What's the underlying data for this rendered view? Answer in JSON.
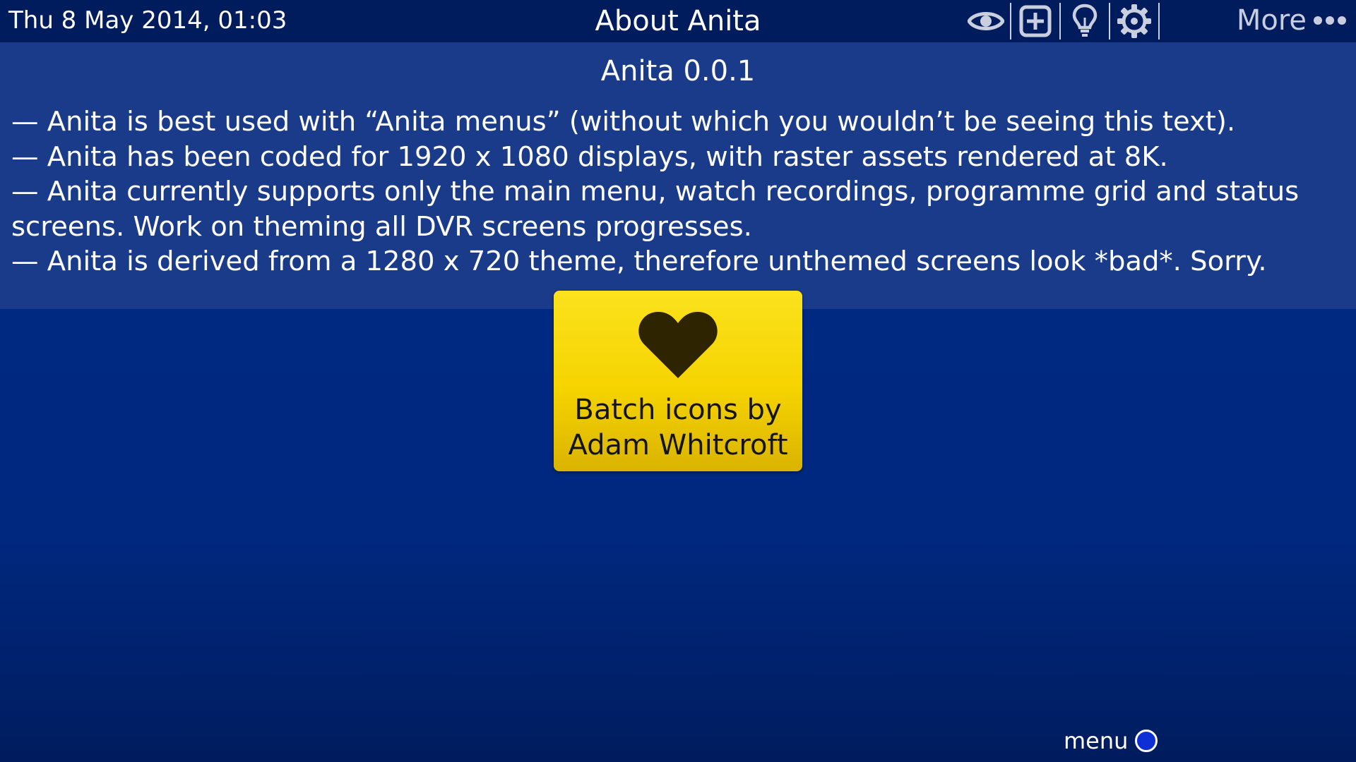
{
  "header": {
    "datetime": "Thu 8 May 2014, 01:03",
    "title": "About Anita",
    "icons": [
      {
        "name": "eye-icon"
      },
      {
        "name": "add-icon"
      },
      {
        "name": "lightbulb-icon"
      },
      {
        "name": "gear-icon"
      }
    ],
    "more_label": "More"
  },
  "info": {
    "version": "Anita 0.0.1",
    "notes": [
      "— Anita is best used with “Anita menus” (without which you wouldn’t be seeing this text).",
      "— Anita has been coded for 1920 x 1080 displays, with raster assets rendered at 8K.",
      "— Anita currently supports only the main menu, watch recordings, programme grid and status screens. Work on theming all DVR screens progresses.",
      "— Anita is derived from a 1280 x 720 theme, therefore unthemed screens look *bad*. Sorry."
    ]
  },
  "credit": {
    "icon": "heart-icon",
    "line1": "Batch icons by",
    "line2": "Adam Whitcroft",
    "color": "#f5d300"
  },
  "footer": {
    "menu_label": "menu",
    "button_color": "#0f2fd6"
  },
  "colors": {
    "background": "#00287f",
    "topbar": "#001c5c",
    "panel": "#1a3b8a"
  }
}
